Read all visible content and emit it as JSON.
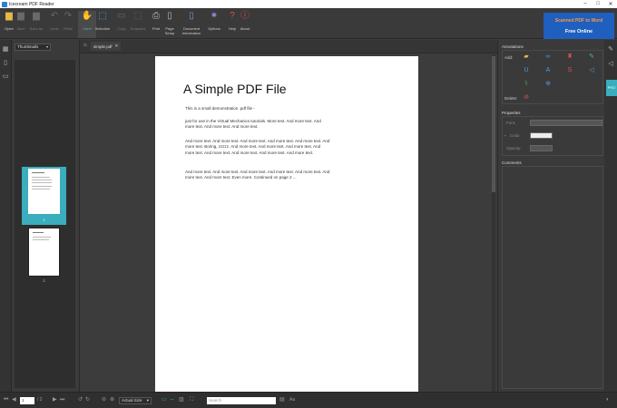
{
  "window": {
    "title": "Icecream PDF Reader"
  },
  "toolbar": {
    "open": "Open",
    "save": "Save",
    "save_as": "Save As",
    "undo": "Undo",
    "redo": "Redo",
    "hand": "Hand",
    "selection": "Selection",
    "copy": "Copy",
    "snapshot": "Snapshot",
    "print": "Print",
    "page_setup": "Page Setup",
    "document_information": "Document Information",
    "options": "Options",
    "help": "Help",
    "about": "About"
  },
  "promo": {
    "line1": "Scanned PDF to Word",
    "line2": "Free Online"
  },
  "thumbnails": {
    "mode": "Thumbnails",
    "page1": "1",
    "page2": "2"
  },
  "tab": {
    "name": "simple.pdf"
  },
  "pdf": {
    "title": "A Simple PDF File",
    "p1": "This is a small demonstration .pdf file -",
    "p2": "just for use in the Virtual Mechanics tutorials. More text. And more text. And more text. And more text. And more text.",
    "p3": "And more text. And more text. And more text. And more text. And more text. And more text. Boring, zzzzz. And more text. And more text. And more text. And more text. And more text. And more text. And more text. And more text.",
    "p4": "And more text. And more text. And more text. And more text. And more text. And more text. And more text. Even more. Continued on page 2 ..."
  },
  "annotations": {
    "title": "Annotations",
    "add": "Add:",
    "delete": "Delete:"
  },
  "properties": {
    "title": "Properties",
    "font": "Font:",
    "color": "Color:",
    "opacity": "Opacity:"
  },
  "comments": {
    "title": "Comments"
  },
  "right_strip": {
    "pro": "PRO"
  },
  "status": {
    "page": "1",
    "total": "/ 2",
    "zoom": "Actual Size",
    "search_placeholder": "Search",
    "aa": "Aa"
  },
  "colors": {
    "accent": "#3aaebd",
    "promo_bg": "#1f5fbf",
    "promo_text": "#ff9a3c"
  },
  "icons": [
    "folder-icon",
    "save-icon",
    "undo-icon",
    "redo-icon",
    "hand-icon",
    "cursor-icon",
    "print-icon",
    "gear-icon",
    "help-icon",
    "info-icon"
  ]
}
